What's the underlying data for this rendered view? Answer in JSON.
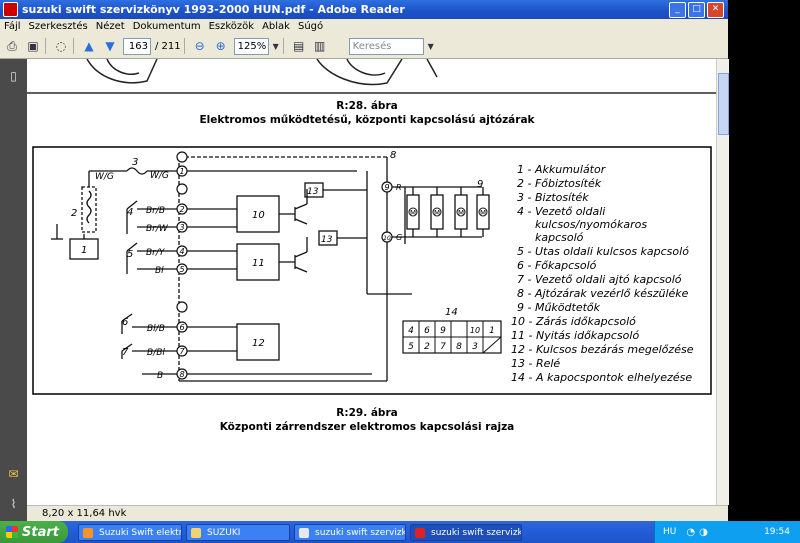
{
  "window": {
    "title": "suzuki swift szervizkönyv 1993-2000 HUN.pdf - Adobe Reader",
    "buttons": {
      "minimize": "_",
      "maximize": "□",
      "close": "✕"
    }
  },
  "menu": [
    "Fájl",
    "Szerkesztés",
    "Nézet",
    "Dokumentum",
    "Eszközök",
    "Ablak",
    "Súgó"
  ],
  "toolbar": {
    "page_current": "163",
    "page_total": "/ 211",
    "zoom": "125%",
    "search_placeholder": "Keresés"
  },
  "document": {
    "top_caption_number": "R:28. ábra",
    "top_caption_title": "Elektromos működtetésű, központi kapcsolású ajtózárak",
    "bottom_caption_number": "R:29. ábra",
    "bottom_caption_title": "Központi zárrendszer elektromos kapcsolási rajza",
    "legend": [
      "1 - Akkumulátor",
      "2 - Főbiztosíték",
      "3 - Biztosíték",
      "4 - Vezető oldali",
      "kulcsos/nyomókaros",
      "kapcsoló",
      "5 - Utas oldali kulcsos kapcsoló",
      "6 - Főkapcsoló",
      "7 - Vezető oldali ajtó kapcsoló",
      "8 - Ajtózárak vezérlő készüléke",
      "9 - Működtetők",
      "10 - Zárás időkapcsoló",
      "11 - Nyitás időkapcsoló",
      "12 - Kulcsos bezárás megelőzése",
      "13 - Relé",
      "14 - A kapocspontok elhelyezése"
    ],
    "diagram_labels": {
      "n1": "1",
      "n2": "2",
      "n3": "3",
      "n4": "4",
      "n5": "5",
      "n6": "6",
      "n7": "7",
      "n8": "8",
      "n9": "9",
      "n10": "10",
      "n11": "11",
      "n12": "12",
      "n13a": "13",
      "n13b": "13",
      "n14": "14",
      "wg_left": "W/G",
      "wg_right": "W/G",
      "br_b": "Br/B",
      "br_w": "Br/W",
      "br_y": "Br/Y",
      "bl": "Bl",
      "bl_b": "Bl/B",
      "b_bl": "B/Bl",
      "b": "B",
      "r": "R",
      "g": "G",
      "t1": "1",
      "t2": "2",
      "t3": "3",
      "t4": "4",
      "t5": "5",
      "t6": "6",
      "t7": "7",
      "t8": "8",
      "t9": "9",
      "t10": "10",
      "motor": "M",
      "conn_top": [
        "4",
        "6",
        "9",
        "",
        "10",
        "1"
      ],
      "conn_bottom": [
        "5",
        "2",
        "7",
        "8",
        "3",
        ""
      ]
    }
  },
  "status": {
    "page_size": "8,20 x 11,64 hvk"
  },
  "taskbar": {
    "start": "Start",
    "tasks": [
      "Suzuki Swift elektrom...",
      "SUZUKI",
      "suzuki swift szervizkö...",
      "suzuki swift szervizkö..."
    ],
    "lang": "HU",
    "clock": "19:54"
  }
}
